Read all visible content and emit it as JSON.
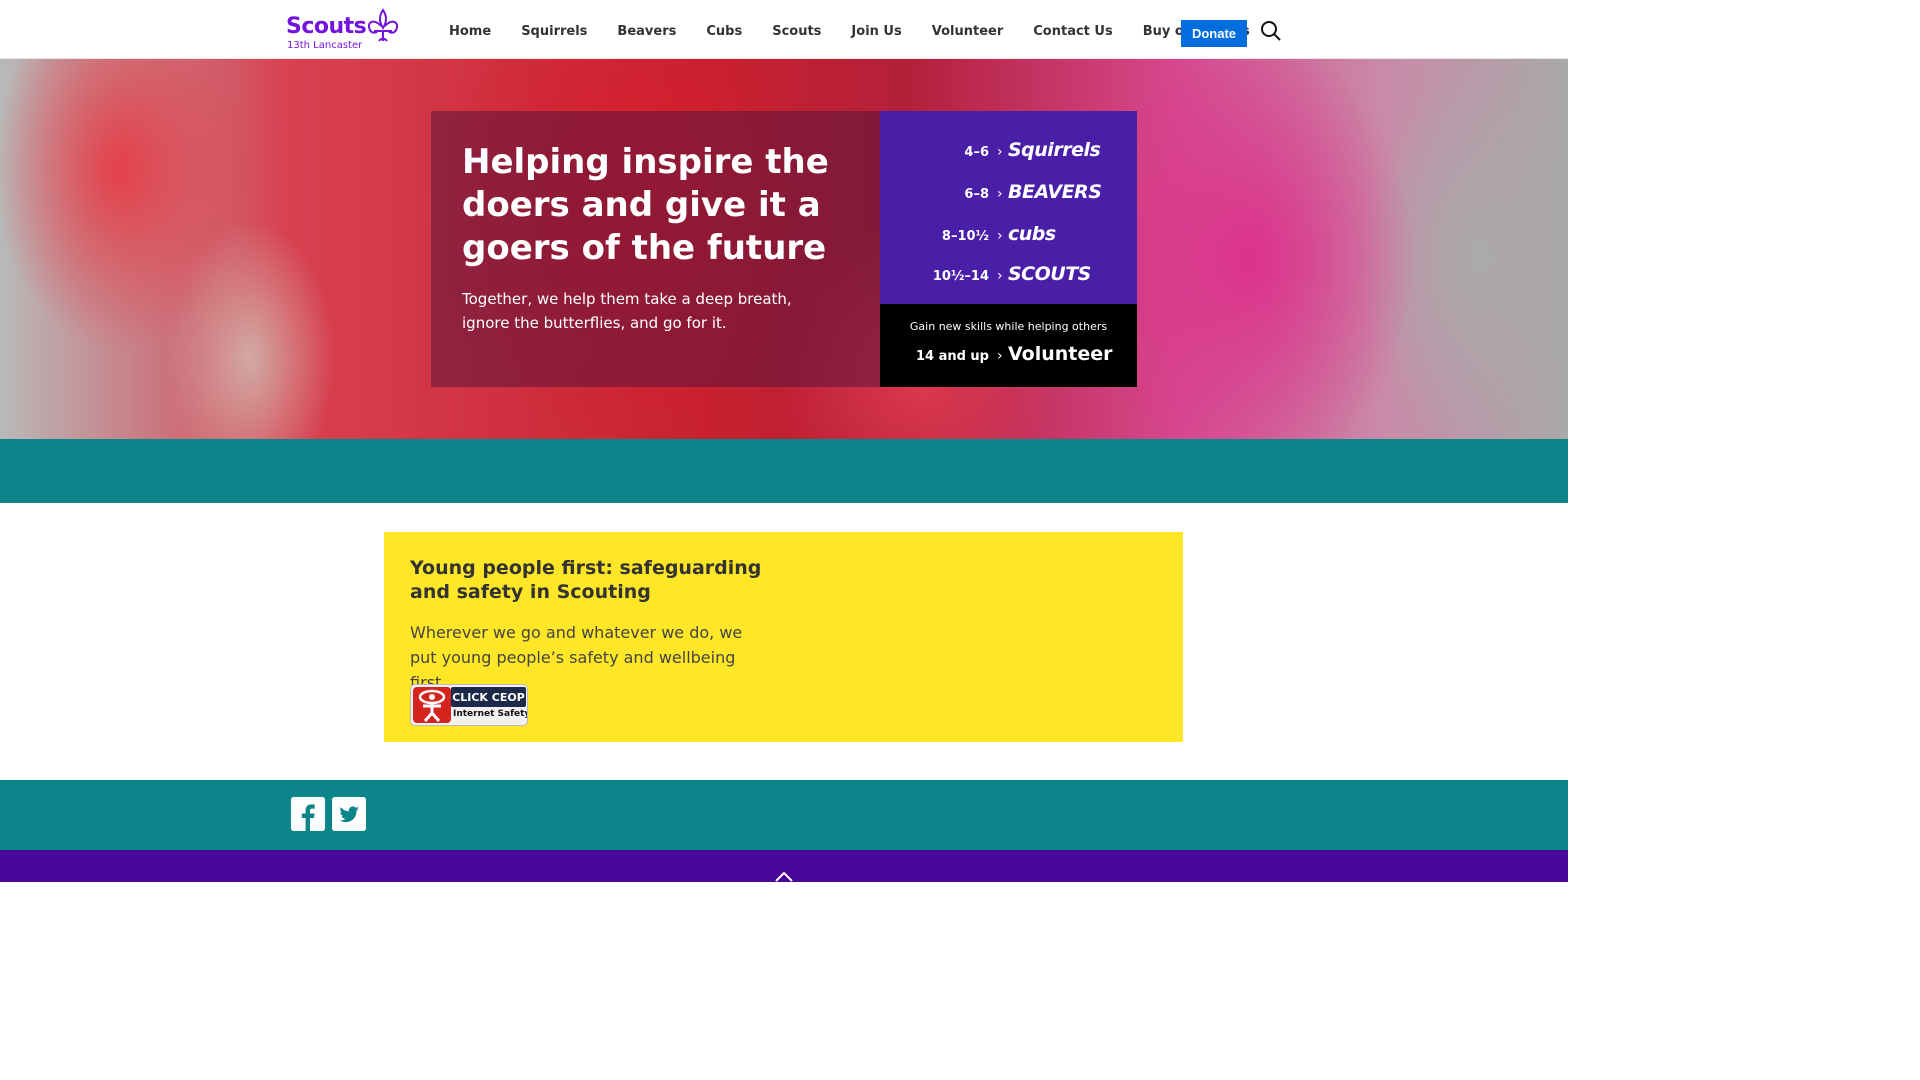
{
  "header": {
    "logo_text": "Scouts",
    "logo_subtitle": "13th Lancaster",
    "nav": [
      "Home",
      "Squirrels",
      "Beavers",
      "Cubs",
      "Scouts",
      "Join Us",
      "Volunteer",
      "Contact Us",
      "Buy our plants"
    ],
    "donate_label": "Donate",
    "search_icon": "search-icon"
  },
  "hero": {
    "title": "Helping inspire the doers and give it a goers of the future",
    "text": "Together, we help them take a deep breath, ignore the butterflies, and go for it.",
    "sections": [
      {
        "age": "4–6",
        "name": "Squirrels"
      },
      {
        "age": "6–8",
        "name": "BEAVERS"
      },
      {
        "age": "8–10½",
        "name": "cubs"
      },
      {
        "age": "10½–14",
        "name": "SCOUTS"
      }
    ],
    "volunteer": {
      "caption": "Gain new skills while helping others",
      "age": "14 and up",
      "name": "Volunteer"
    }
  },
  "safeguarding": {
    "title": "Young people first: safeguarding and safety in Scouting",
    "text": "Wherever we go and whatever we do, we put young people’s safety and wellbeing first.",
    "ceop_top": "CLICK CEOP",
    "ceop_bottom": "Internet Safety"
  },
  "footer": {
    "social_icons": [
      "facebook-icon",
      "twitter-icon"
    ],
    "back_to_top_icon": "chevron-up-icon"
  },
  "colors": {
    "brand_purple": "#7413dc",
    "section_purple": "#4a1fa8",
    "footer_purple": "#490499",
    "teal": "#0b8589",
    "yellow": "#ffe627",
    "donate_blue": "#006ddf"
  }
}
